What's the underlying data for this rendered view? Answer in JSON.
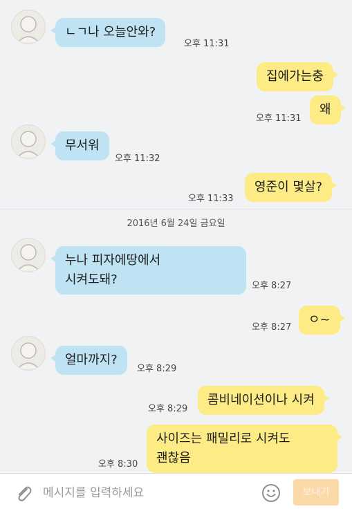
{
  "messages": [
    {
      "text": "ㄴㄱ나 오늘안와?",
      "time": "오후 11:31"
    },
    {
      "text": "집에가는충",
      "time": ""
    },
    {
      "text": "왜",
      "time": "오후 11:31"
    },
    {
      "text": "무서워",
      "time": "오후 11:32"
    },
    {
      "text": "영준이 몇살?",
      "time": "오후 11:33"
    },
    {
      "text_line1": "누나 피자에땅에서",
      "text_line2": "시켜도돼?",
      "time": "오후 8:27"
    },
    {
      "text": "ㅇ~",
      "time": "오후 8:27"
    },
    {
      "text": "얼마까지?",
      "time": "오후 8:29"
    },
    {
      "text": "콤비네이션이나 시켜",
      "time": "오후 8:29"
    },
    {
      "text_line1": "사이즈는 패밀리로 시켜도",
      "text_line2": "괜찮음",
      "time": "오후 8:30"
    }
  ],
  "date_separator": "2016년 6월 24일 금요일",
  "input": {
    "placeholder": "메시지를 입력하세요",
    "send_label": "보내기"
  },
  "colors": {
    "incoming": "#bfe3f3",
    "outgoing": "#fdeb86",
    "send": "#fbd9a9",
    "background": "#f1f2f4"
  },
  "icons": {
    "attach": "paperclip-icon",
    "emoji": "smiley-icon"
  }
}
